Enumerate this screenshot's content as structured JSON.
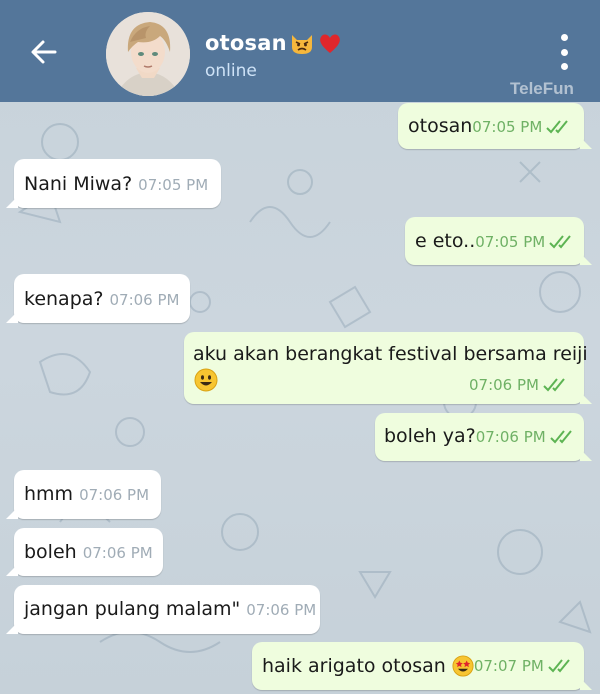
{
  "header": {
    "name": "otosan",
    "status": "online",
    "watermark": "TeleFun",
    "emojis": [
      "angry-cat-face",
      "red-heart"
    ],
    "color": "#54769a"
  },
  "messages": [
    {
      "dir": "out",
      "text": "otosan",
      "time": "07:05 PM",
      "read": true
    },
    {
      "dir": "in",
      "text": "Nani Miwa?",
      "time": "07:05 PM"
    },
    {
      "dir": "out",
      "text": "e eto..",
      "time": "07:05 PM",
      "read": true
    },
    {
      "dir": "in",
      "text": "kenapa?",
      "time": "07:06 PM"
    },
    {
      "dir": "out",
      "text": "aku akan berangkat festival bersama reiji",
      "emoji": "smiling-face",
      "time": "07:06 PM",
      "read": true
    },
    {
      "dir": "out",
      "text": "boleh ya?",
      "time": "07:06 PM",
      "read": true
    },
    {
      "dir": "in",
      "text": "hmm",
      "time": "07:06 PM"
    },
    {
      "dir": "in",
      "text": "boleh",
      "time": "07:06 PM"
    },
    {
      "dir": "in",
      "text": "jangan pulang malam\"",
      "time": "07:06 PM"
    },
    {
      "dir": "out",
      "text": "haik arigato otosan",
      "emoji": "star-struck-face",
      "time": "07:07 PM",
      "read": true
    }
  ],
  "colors": {
    "incoming_bubble": "#ffffff",
    "outgoing_bubble": "#effdde",
    "outgoing_time": "#6fb165",
    "incoming_time": "#a0acb6"
  }
}
